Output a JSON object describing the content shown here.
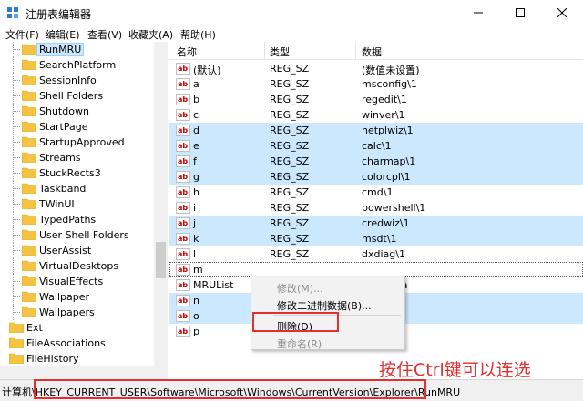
{
  "window": {
    "title": "注册表编辑器",
    "icons": {
      "app": "regedit-icon",
      "minimize": "minimize-icon",
      "maximize": "maximize-icon",
      "close": "close-icon"
    }
  },
  "menu": [
    "文件(F)",
    "编辑(E)",
    "查看(V)",
    "收藏夹(A)",
    "帮助(H)"
  ],
  "tree": {
    "items": [
      {
        "label": "RunMRU",
        "selected": true
      },
      {
        "label": "SearchPlatform"
      },
      {
        "label": "SessionInfo"
      },
      {
        "label": "Shell Folders"
      },
      {
        "label": "Shutdown"
      },
      {
        "label": "StartPage"
      },
      {
        "label": "StartupApproved"
      },
      {
        "label": "Streams"
      },
      {
        "label": "StuckRects3"
      },
      {
        "label": "Taskband"
      },
      {
        "label": "TWinUI"
      },
      {
        "label": "TypedPaths"
      },
      {
        "label": "User Shell Folders"
      },
      {
        "label": "UserAssist"
      },
      {
        "label": "VirtualDesktops"
      },
      {
        "label": "VisualEffects"
      },
      {
        "label": "Wallpaper"
      },
      {
        "label": "Wallpapers"
      },
      {
        "label": "Ext"
      },
      {
        "label": "FileAssociations"
      },
      {
        "label": "FileHistory"
      }
    ]
  },
  "list": {
    "headers": {
      "name": "名称",
      "type": "类型",
      "data": "数据"
    },
    "rows": [
      {
        "name": "(默认)",
        "type": "REG_SZ",
        "data": "(数值未设置)",
        "sel": false
      },
      {
        "name": "a",
        "type": "REG_SZ",
        "data": "msconfig\\1",
        "sel": false
      },
      {
        "name": "b",
        "type": "REG_SZ",
        "data": "regedit\\1",
        "sel": false
      },
      {
        "name": "c",
        "type": "REG_SZ",
        "data": "winver\\1",
        "sel": false
      },
      {
        "name": "d",
        "type": "REG_SZ",
        "data": "netplwiz\\1",
        "sel": true
      },
      {
        "name": "e",
        "type": "REG_SZ",
        "data": "calc\\1",
        "sel": true
      },
      {
        "name": "f",
        "type": "REG_SZ",
        "data": "charmap\\1",
        "sel": true
      },
      {
        "name": "g",
        "type": "REG_SZ",
        "data": "colorcpl\\1",
        "sel": true
      },
      {
        "name": "h",
        "type": "REG_SZ",
        "data": "cmd\\1",
        "sel": false
      },
      {
        "name": "i",
        "type": "REG_SZ",
        "data": "powershell\\1",
        "sel": false
      },
      {
        "name": "j",
        "type": "REG_SZ",
        "data": "credwiz\\1",
        "sel": true
      },
      {
        "name": "k",
        "type": "REG_SZ",
        "data": "msdt\\1",
        "sel": true
      },
      {
        "name": "l",
        "type": "REG_SZ",
        "data": "dxdiag\\1",
        "sel": false
      },
      {
        "name": "m",
        "type": "",
        "data": "",
        "sel": false,
        "focus": true
      },
      {
        "name": "MRUList",
        "type": "",
        "data": "jihgfedca",
        "sel": false
      },
      {
        "name": "n",
        "type": "",
        "data": "",
        "sel": true
      },
      {
        "name": "o",
        "type": "",
        "data": "",
        "sel": true
      },
      {
        "name": "p",
        "type": "",
        "data": "\\1",
        "sel": false
      }
    ]
  },
  "context_menu": {
    "modify": "修改(M)...",
    "modify_binary": "修改二进制数据(B)...",
    "delete": "删除(D)",
    "rename": "重命名(R)"
  },
  "status": {
    "path": "计算机\\HKEY_CURRENT_USER\\Software\\Microsoft\\Windows\\CurrentVersion\\Explorer\\RunMRU"
  },
  "annotation": "按住Ctrl键可以连选",
  "colors": {
    "selection": "#cce8ff",
    "highlight_box": "#e03030",
    "folder": "#f5c342"
  }
}
